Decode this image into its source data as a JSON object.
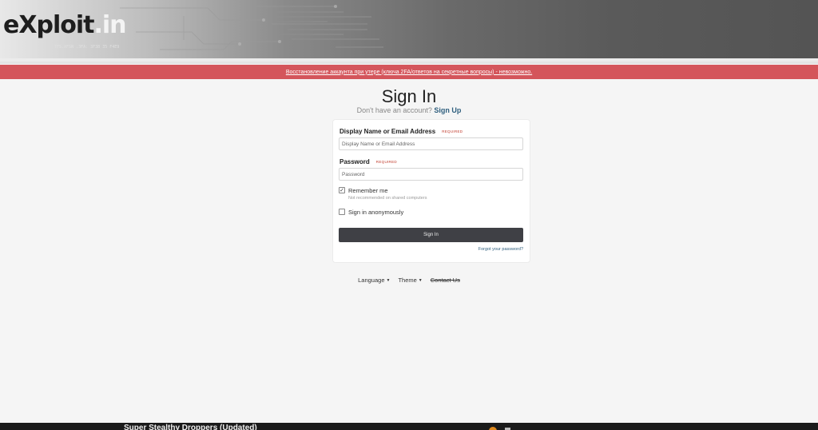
{
  "header": {
    "logo_main": "eXploit",
    "logo_dot_in": ".in",
    "logo_tiny": "TFS.XFSN .3FA: 3F3B 35 F4E9"
  },
  "notice": {
    "text": "Восстановление аккаунта при утере (ключа 2FA/ответов на секретные вопросы) - невозможно."
  },
  "signin": {
    "title": "Sign In",
    "no_account": "Don't have an account?",
    "signup_link": "Sign Up"
  },
  "form": {
    "name_label": "Display Name or Email Address",
    "name_required": "REQUIRED",
    "name_placeholder": "Display Name or Email Address",
    "password_label": "Password",
    "password_required": "REQUIRED",
    "password_placeholder": "Password",
    "remember_label": "Remember me",
    "remember_hint": "Not recommended on shared computers",
    "remember_checked": true,
    "anon_label": "Sign in anonymously",
    "anon_checked": false,
    "submit_label": "Sign In",
    "forgot_link": "Forgot your password?"
  },
  "footer": {
    "language": "Language",
    "theme": "Theme",
    "contact": "Contact Us"
  },
  "bottom_bar": {
    "text": "Super Stealthy Droppers (Updated)"
  },
  "colors": {
    "notice_bg": "#d4555b",
    "button_bg": "#3f4045",
    "link": "#2f5f7e",
    "required": "#c0392b"
  }
}
